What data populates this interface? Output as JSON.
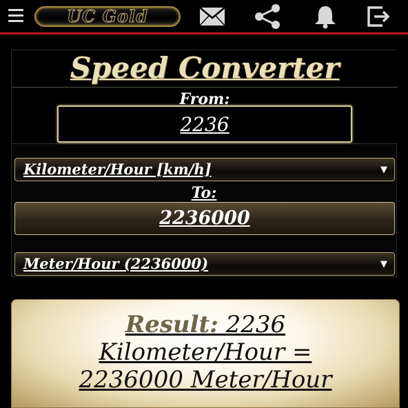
{
  "topbar": {
    "brand": "UC Gold",
    "icons": [
      "menu-icon",
      "mail-icon",
      "share-icon",
      "bell-icon",
      "exit-icon"
    ]
  },
  "converter": {
    "title": "Speed Converter",
    "from_label": "From:",
    "from_value": "2236",
    "from_unit": "Kilometer/Hour [km/h]",
    "to_label": "To:",
    "to_value": "2236000",
    "to_unit": "Meter/Hour (2236000)"
  },
  "result": {
    "prefix": "Result:",
    "line1_value": "2236",
    "line2": "Kilometer/Hour =",
    "line3": "2236000 Meter/Hour"
  },
  "colors": {
    "accent_red": "#c01818",
    "gold": "#d6c99a"
  }
}
